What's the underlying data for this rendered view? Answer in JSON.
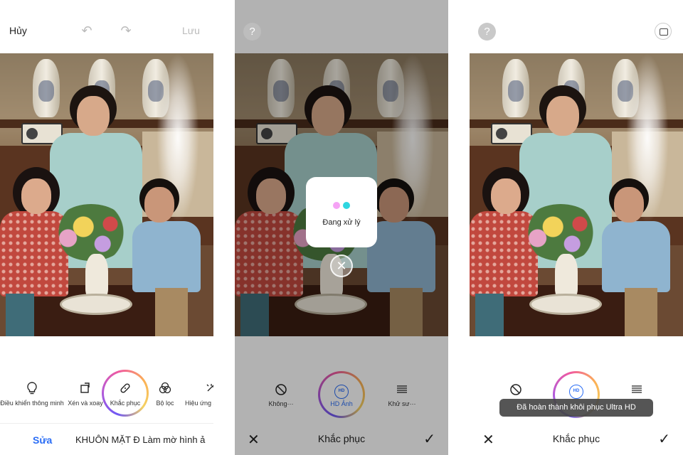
{
  "panel1": {
    "header": {
      "cancel": "Hủy",
      "save": "Lưu"
    },
    "tools": [
      {
        "label": "Điều khiển thông minh",
        "icon": "bulb-icon"
      },
      {
        "label": "Xén và xoay",
        "icon": "crop-rotate-icon"
      },
      {
        "label": "Khắc phục",
        "icon": "bandage-icon"
      },
      {
        "label": "Bộ lọc",
        "icon": "filter-icon"
      },
      {
        "label": "Hiệu ứng ả",
        "icon": "sparkle-icon"
      }
    ],
    "bottom": {
      "edit": "Sửa",
      "crumbs": "KHUÔN MẶT Đ Làm mờ hình ả"
    }
  },
  "panel2": {
    "help": "?",
    "modal": {
      "message": "Đang xử lý"
    },
    "options": [
      {
        "label": "Không···",
        "icon": "none-icon"
      },
      {
        "label": "HD Ảnh",
        "icon": "hd-icon"
      },
      {
        "label": "Khử sư···",
        "icon": "lines-icon"
      }
    ],
    "actionbar": {
      "title": "Khắc phục"
    }
  },
  "panel3": {
    "help": "?",
    "toast": "Đã hoàn thành khôi phục Ultra HD",
    "hd_label": "HD",
    "actionbar": {
      "title": "Khắc phục"
    }
  },
  "colors": {
    "accent": "#2a6df5",
    "dot_pink": "#f5a3f5",
    "dot_cyan": "#2ed6e0"
  }
}
